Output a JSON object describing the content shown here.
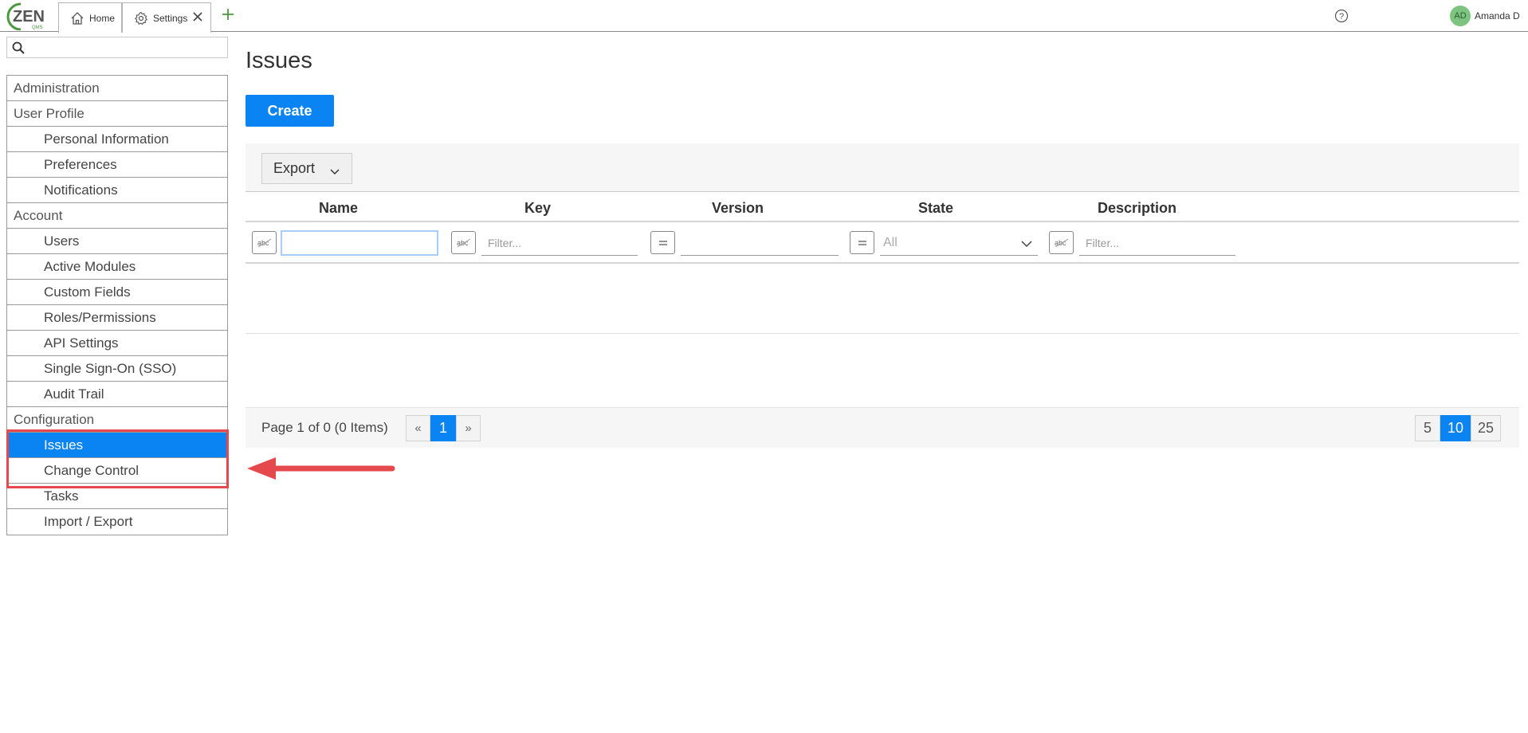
{
  "topbar": {
    "logo_text": "ZEN",
    "logo_sub": "QMS",
    "tabs": [
      {
        "label": "Home",
        "icon": "home-icon"
      },
      {
        "label": "Settings",
        "icon": "gear-icon"
      }
    ],
    "user": {
      "initials": "AD",
      "name": "Amanda D"
    },
    "colors": {
      "accent_green": "#4a9a3c",
      "avatar_bg": "#7cc47f"
    }
  },
  "sidebar": {
    "search_placeholder": "",
    "items": [
      {
        "label": "Administration",
        "level": "section"
      },
      {
        "label": "User Profile",
        "level": "section"
      },
      {
        "label": "Personal Information",
        "level": "child"
      },
      {
        "label": "Preferences",
        "level": "child"
      },
      {
        "label": "Notifications",
        "level": "child"
      },
      {
        "label": "Account",
        "level": "section"
      },
      {
        "label": "Users",
        "level": "child"
      },
      {
        "label": "Active Modules",
        "level": "child"
      },
      {
        "label": "Custom Fields",
        "level": "child"
      },
      {
        "label": "Roles/Permissions",
        "level": "child"
      },
      {
        "label": "API Settings",
        "level": "child"
      },
      {
        "label": "Single Sign-On (SSO)",
        "level": "child"
      },
      {
        "label": "Audit Trail",
        "level": "child"
      },
      {
        "label": "Configuration",
        "level": "section"
      },
      {
        "label": "Issues",
        "level": "child",
        "active": true
      },
      {
        "label": "Change Control",
        "level": "child"
      },
      {
        "label": "Tasks",
        "level": "child"
      },
      {
        "label": "Import / Export",
        "level": "child"
      }
    ]
  },
  "main": {
    "title": "Issues",
    "create_label": "Create",
    "export_label": "Export",
    "columns": [
      "Name",
      "Key",
      "Version",
      "State",
      "Description"
    ],
    "filters": {
      "name_value": "",
      "key_placeholder": "Filter...",
      "version_value": "",
      "state_value": "All",
      "description_placeholder": "Filter..."
    },
    "pager": {
      "info": "Page 1 of 0 (0 Items)",
      "prev": "«",
      "current_page": "1",
      "next": "»",
      "sizes": [
        "5",
        "10",
        "25"
      ],
      "current_size": "10"
    },
    "colors": {
      "primary": "#0b84f3",
      "annotation_red": "#e5494d"
    }
  }
}
